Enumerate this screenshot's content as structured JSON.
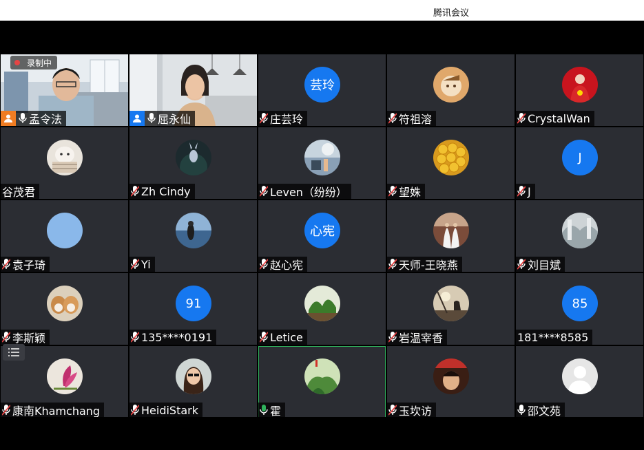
{
  "window": {
    "title": "腾讯会议"
  },
  "recording": {
    "label": "录制中"
  },
  "colors": {
    "tile_bg": "#2b2d33",
    "accent_blue": "#1678f0",
    "active_green": "#2fb15c",
    "rec_red": "#e54545",
    "host_orange": "#f07c22"
  },
  "participants": [
    {
      "name": "孟令法",
      "mic": "on",
      "host": true,
      "video": true
    },
    {
      "name": "屈永仙",
      "mic": "on",
      "cohost": true,
      "video": true
    },
    {
      "name": "庄芸玲",
      "mic": "muted",
      "avatar_text": "芸玲"
    },
    {
      "name": "符祖溶",
      "mic": "muted",
      "avatar": "photo"
    },
    {
      "name": "CrystalWan",
      "mic": "muted",
      "avatar": "photo"
    },
    {
      "name": "谷茂君",
      "mic": "none",
      "avatar": "photo"
    },
    {
      "name": "Zh Cindy",
      "mic": "muted",
      "avatar": "photo"
    },
    {
      "name": "Leven（纷纷）",
      "mic": "muted",
      "avatar": "photo"
    },
    {
      "name": "望姝",
      "mic": "muted",
      "avatar": "photo"
    },
    {
      "name": "J",
      "mic": "muted",
      "avatar_text": "J"
    },
    {
      "name": "袁子琦",
      "mic": "muted",
      "avatar": "photo"
    },
    {
      "name": "Yi",
      "mic": "muted",
      "avatar": "photo"
    },
    {
      "name": "赵心宪",
      "mic": "muted",
      "avatar_text": "心宪"
    },
    {
      "name": "天师-王晓燕",
      "mic": "muted",
      "avatar": "photo"
    },
    {
      "name": "刘目斌",
      "mic": "muted",
      "avatar": "photo"
    },
    {
      "name": "李斯颖",
      "mic": "muted",
      "avatar": "photo"
    },
    {
      "name": "135****0191",
      "mic": "muted",
      "avatar_text": "91"
    },
    {
      "name": "Letice",
      "mic": "muted",
      "avatar": "photo"
    },
    {
      "name": "岩温宰香",
      "mic": "muted",
      "avatar": "photo"
    },
    {
      "name": "181****8585",
      "mic": "none",
      "avatar_text": "85"
    },
    {
      "name": "康南Khamchang",
      "mic": "muted",
      "avatar": "photo"
    },
    {
      "name": "HeidiStark",
      "mic": "muted",
      "avatar": "photo"
    },
    {
      "name": "霍",
      "mic": "speaking",
      "avatar": "photo",
      "active": true
    },
    {
      "name": "玉坎访",
      "mic": "muted",
      "avatar": "photo"
    },
    {
      "name": "邵文苑",
      "mic": "on",
      "avatar": "default"
    }
  ]
}
